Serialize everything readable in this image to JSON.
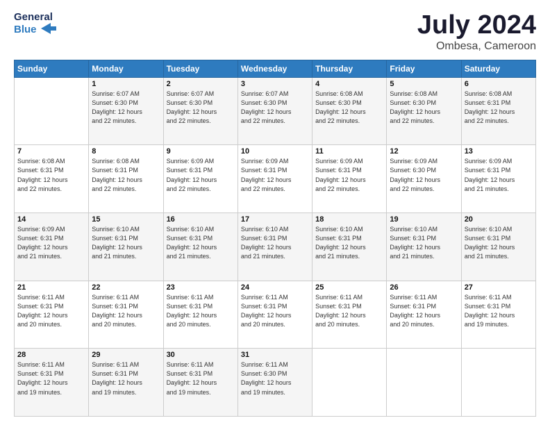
{
  "logo": {
    "line1": "General",
    "line2": "Blue"
  },
  "title": "July 2024",
  "location": "Ombesa, Cameroon",
  "header_days": [
    "Sunday",
    "Monday",
    "Tuesday",
    "Wednesday",
    "Thursday",
    "Friday",
    "Saturday"
  ],
  "weeks": [
    [
      {
        "day": "",
        "info": ""
      },
      {
        "day": "1",
        "info": "Sunrise: 6:07 AM\nSunset: 6:30 PM\nDaylight: 12 hours\nand 22 minutes."
      },
      {
        "day": "2",
        "info": "Sunrise: 6:07 AM\nSunset: 6:30 PM\nDaylight: 12 hours\nand 22 minutes."
      },
      {
        "day": "3",
        "info": "Sunrise: 6:07 AM\nSunset: 6:30 PM\nDaylight: 12 hours\nand 22 minutes."
      },
      {
        "day": "4",
        "info": "Sunrise: 6:08 AM\nSunset: 6:30 PM\nDaylight: 12 hours\nand 22 minutes."
      },
      {
        "day": "5",
        "info": "Sunrise: 6:08 AM\nSunset: 6:30 PM\nDaylight: 12 hours\nand 22 minutes."
      },
      {
        "day": "6",
        "info": "Sunrise: 6:08 AM\nSunset: 6:31 PM\nDaylight: 12 hours\nand 22 minutes."
      }
    ],
    [
      {
        "day": "7",
        "info": "Sunrise: 6:08 AM\nSunset: 6:31 PM\nDaylight: 12 hours\nand 22 minutes."
      },
      {
        "day": "8",
        "info": "Sunrise: 6:08 AM\nSunset: 6:31 PM\nDaylight: 12 hours\nand 22 minutes."
      },
      {
        "day": "9",
        "info": "Sunrise: 6:09 AM\nSunset: 6:31 PM\nDaylight: 12 hours\nand 22 minutes."
      },
      {
        "day": "10",
        "info": "Sunrise: 6:09 AM\nSunset: 6:31 PM\nDaylight: 12 hours\nand 22 minutes."
      },
      {
        "day": "11",
        "info": "Sunrise: 6:09 AM\nSunset: 6:31 PM\nDaylight: 12 hours\nand 22 minutes."
      },
      {
        "day": "12",
        "info": "Sunrise: 6:09 AM\nSunset: 6:30 PM\nDaylight: 12 hours\nand 22 minutes."
      },
      {
        "day": "13",
        "info": "Sunrise: 6:09 AM\nSunset: 6:31 PM\nDaylight: 12 hours\nand 21 minutes."
      }
    ],
    [
      {
        "day": "14",
        "info": "Sunrise: 6:09 AM\nSunset: 6:31 PM\nDaylight: 12 hours\nand 21 minutes."
      },
      {
        "day": "15",
        "info": "Sunrise: 6:10 AM\nSunset: 6:31 PM\nDaylight: 12 hours\nand 21 minutes."
      },
      {
        "day": "16",
        "info": "Sunrise: 6:10 AM\nSunset: 6:31 PM\nDaylight: 12 hours\nand 21 minutes."
      },
      {
        "day": "17",
        "info": "Sunrise: 6:10 AM\nSunset: 6:31 PM\nDaylight: 12 hours\nand 21 minutes."
      },
      {
        "day": "18",
        "info": "Sunrise: 6:10 AM\nSunset: 6:31 PM\nDaylight: 12 hours\nand 21 minutes."
      },
      {
        "day": "19",
        "info": "Sunrise: 6:10 AM\nSunset: 6:31 PM\nDaylight: 12 hours\nand 21 minutes."
      },
      {
        "day": "20",
        "info": "Sunrise: 6:10 AM\nSunset: 6:31 PM\nDaylight: 12 hours\nand 21 minutes."
      }
    ],
    [
      {
        "day": "21",
        "info": "Sunrise: 6:11 AM\nSunset: 6:31 PM\nDaylight: 12 hours\nand 20 minutes."
      },
      {
        "day": "22",
        "info": "Sunrise: 6:11 AM\nSunset: 6:31 PM\nDaylight: 12 hours\nand 20 minutes."
      },
      {
        "day": "23",
        "info": "Sunrise: 6:11 AM\nSunset: 6:31 PM\nDaylight: 12 hours\nand 20 minutes."
      },
      {
        "day": "24",
        "info": "Sunrise: 6:11 AM\nSunset: 6:31 PM\nDaylight: 12 hours\nand 20 minutes."
      },
      {
        "day": "25",
        "info": "Sunrise: 6:11 AM\nSunset: 6:31 PM\nDaylight: 12 hours\nand 20 minutes."
      },
      {
        "day": "26",
        "info": "Sunrise: 6:11 AM\nSunset: 6:31 PM\nDaylight: 12 hours\nand 20 minutes."
      },
      {
        "day": "27",
        "info": "Sunrise: 6:11 AM\nSunset: 6:31 PM\nDaylight: 12 hours\nand 19 minutes."
      }
    ],
    [
      {
        "day": "28",
        "info": "Sunrise: 6:11 AM\nSunset: 6:31 PM\nDaylight: 12 hours\nand 19 minutes."
      },
      {
        "day": "29",
        "info": "Sunrise: 6:11 AM\nSunset: 6:31 PM\nDaylight: 12 hours\nand 19 minutes."
      },
      {
        "day": "30",
        "info": "Sunrise: 6:11 AM\nSunset: 6:31 PM\nDaylight: 12 hours\nand 19 minutes."
      },
      {
        "day": "31",
        "info": "Sunrise: 6:11 AM\nSunset: 6:30 PM\nDaylight: 12 hours\nand 19 minutes."
      },
      {
        "day": "",
        "info": ""
      },
      {
        "day": "",
        "info": ""
      },
      {
        "day": "",
        "info": ""
      }
    ]
  ]
}
